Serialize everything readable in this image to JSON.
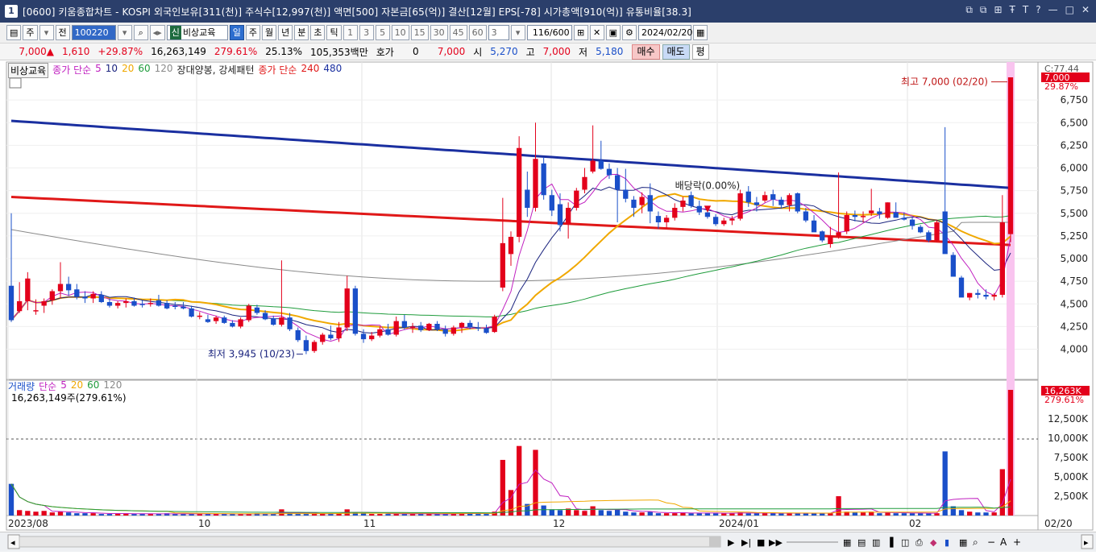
{
  "window": {
    "icon_label": "1",
    "title": "[0600] 키움종합차트 - KOSPI 외국인보유[311(천)] 주식수[12,997(천)] 액면[500] 자본금[65(억)] 결산[12월] EPS[-78] 시가총액[910(억)] 유통비율[38.3]",
    "controls": [
      "⧉",
      "⧉",
      "⊞",
      "Ŧ",
      "T",
      "?",
      "—",
      "□",
      "✕"
    ]
  },
  "toolbar": {
    "period_type": "주",
    "prev_label": "전",
    "code": "100220",
    "name_tag": "신",
    "name": "비상교육",
    "periods": [
      "일",
      "주",
      "월",
      "년",
      "분",
      "초",
      "틱"
    ],
    "intervals": [
      "1",
      "3",
      "5",
      "10",
      "15",
      "30",
      "45",
      "60"
    ],
    "interval_value": "3",
    "count": "116",
    "count_total": "/600",
    "date": "2024/02/20"
  },
  "quote": {
    "price": "7,000",
    "arrow": "▲",
    "change": "1,610",
    "change_pct": "+29.87%",
    "volume": "16,263,149",
    "volume_pct": "279.61%",
    "turnover": "25.13%",
    "amount": "105,353백만",
    "hoga_label": "호가",
    "hoga_value": "0",
    "hoga_price": "7,000",
    "open_label": "시",
    "open": "5,270",
    "high_label": "고",
    "high": "7,000",
    "low_label": "저",
    "low": "5,180",
    "buy_label": "매수",
    "sell_label": "매도",
    "avg_label": "평"
  },
  "legend_price": {
    "name": "비상교육",
    "ma_label": "종가 단순",
    "ma_periods": [
      "5",
      "10",
      "20",
      "60",
      "120"
    ],
    "pattern": "장대양봉, 강세패턴",
    "ma2_label": "종가 단순",
    "ma2_periods": [
      "240",
      "480"
    ]
  },
  "legend_volume": {
    "name": "거래량",
    "ma_label": "단순",
    "ma_periods": [
      "5",
      "20",
      "60",
      "120"
    ],
    "value_text": "16,263,149주(279.61%)"
  },
  "annotations": {
    "high": "최고 7,000 (02/20)",
    "low": "최저 3,945 (10/23)",
    "dividend": "배당락(0.00%)"
  },
  "price_axis": {
    "labels": [
      "6,750",
      "6,500",
      "6,250",
      "6,000",
      "5,750",
      "5,500",
      "5,250",
      "5,000",
      "4,750",
      "4,500",
      "4,250",
      "4,000"
    ],
    "current_label": "7,000",
    "current_pct": "29.87%",
    "top_label": "C:77.44"
  },
  "volume_axis": {
    "labels": [
      "12,500K",
      "10,000K",
      "7,500K",
      "5,000K",
      "2,500K"
    ],
    "current_label": "16,263K",
    "current_pct": "279.61%"
  },
  "date_axis": [
    "2023/08",
    "10",
    "11",
    "12",
    "2024/01",
    "02",
    "02/20"
  ],
  "colors": {
    "up": "#e3001b",
    "down": "#1a4fc9",
    "ma5": "#c020c0",
    "ma10": "#1a237e",
    "ma20": "#f0a800",
    "ma60": "#1f9c3c",
    "ma120": "#8a8a8a",
    "ma240": "#e01818",
    "ma480": "#1a2fa0",
    "today_band": "#f9c4ef"
  },
  "chart_data": {
    "type": "candlestick",
    "ylim": [
      3800,
      7000
    ],
    "volume_ylim": [
      0,
      16263
    ],
    "candles": [
      [
        4700,
        5500,
        4300,
        4320
      ],
      [
        4420,
        4740,
        4400,
        4530
      ],
      [
        4530,
        4850,
        4430,
        4780
      ],
      [
        4420,
        4550,
        4380,
        4430
      ],
      [
        4480,
        4560,
        4400,
        4530
      ],
      [
        4540,
        4660,
        4490,
        4640
      ],
      [
        4640,
        4960,
        4560,
        4720
      ],
      [
        4720,
        4800,
        4590,
        4650
      ],
      [
        4660,
        4720,
        4550,
        4580
      ],
      [
        4580,
        4640,
        4510,
        4560
      ],
      [
        4560,
        4640,
        4510,
        4610
      ],
      [
        4600,
        4640,
        4510,
        4520
      ],
      [
        4520,
        4560,
        4460,
        4480
      ],
      [
        4480,
        4530,
        4450,
        4510
      ],
      [
        4510,
        4560,
        4460,
        4530
      ],
      [
        4530,
        4570,
        4470,
        4480
      ],
      [
        4500,
        4540,
        4460,
        4490
      ],
      [
        4500,
        4560,
        4470,
        4510
      ],
      [
        4540,
        4600,
        4470,
        4480
      ],
      [
        4510,
        4540,
        4440,
        4450
      ],
      [
        4480,
        4520,
        4440,
        4470
      ],
      [
        4470,
        4520,
        4440,
        4450
      ],
      [
        4450,
        4480,
        4350,
        4360
      ],
      [
        4360,
        4410,
        4330,
        4370
      ],
      [
        4330,
        4380,
        4290,
        4300
      ],
      [
        4310,
        4370,
        4280,
        4350
      ],
      [
        4350,
        4370,
        4280,
        4290
      ],
      [
        4290,
        4320,
        4240,
        4250
      ],
      [
        4250,
        4350,
        4230,
        4330
      ],
      [
        4320,
        4500,
        4300,
        4480
      ],
      [
        4460,
        4490,
        4380,
        4400
      ],
      [
        4400,
        4430,
        4320,
        4330
      ],
      [
        4340,
        4370,
        4260,
        4270
      ],
      [
        4270,
        4980,
        4250,
        4350
      ],
      [
        4350,
        4400,
        4200,
        4220
      ],
      [
        4210,
        4240,
        4080,
        4100
      ],
      [
        4100,
        4150,
        3945,
        3980
      ],
      [
        3980,
        4100,
        3960,
        4080
      ],
      [
        4080,
        4180,
        4050,
        4160
      ],
      [
        4160,
        4260,
        4100,
        4120
      ],
      [
        4120,
        4300,
        4080,
        4240
      ],
      [
        4240,
        4810,
        4200,
        4670
      ],
      [
        4670,
        4700,
        4150,
        4170
      ],
      [
        4170,
        4220,
        4070,
        4110
      ],
      [
        4110,
        4190,
        4090,
        4150
      ],
      [
        4150,
        4250,
        4130,
        4220
      ],
      [
        4220,
        4280,
        4150,
        4160
      ],
      [
        4160,
        4360,
        4140,
        4310
      ],
      [
        4310,
        4380,
        4220,
        4240
      ],
      [
        4240,
        4290,
        4180,
        4250
      ],
      [
        4260,
        4300,
        4190,
        4210
      ],
      [
        4210,
        4290,
        4200,
        4280
      ],
      [
        4280,
        4310,
        4200,
        4220
      ],
      [
        4220,
        4260,
        4140,
        4170
      ],
      [
        4170,
        4260,
        4150,
        4240
      ],
      [
        4240,
        4300,
        4180,
        4290
      ],
      [
        4290,
        4320,
        4220,
        4240
      ],
      [
        4240,
        4300,
        4200,
        4230
      ],
      [
        4230,
        4270,
        4170,
        4180
      ],
      [
        4190,
        4380,
        4180,
        4360
      ],
      [
        4680,
        5670,
        4640,
        5170
      ],
      [
        5050,
        5300,
        4920,
        5240
      ],
      [
        5240,
        6350,
        5180,
        6220
      ],
      [
        5760,
        5960,
        5460,
        5560
      ],
      [
        5560,
        6500,
        5520,
        6100
      ],
      [
        6050,
        6120,
        5650,
        5700
      ],
      [
        5700,
        5760,
        5470,
        5530
      ],
      [
        5600,
        5720,
        5300,
        5370
      ],
      [
        5380,
        5620,
        5220,
        5560
      ],
      [
        5560,
        5780,
        5530,
        5750
      ],
      [
        5760,
        6000,
        5720,
        5900
      ],
      [
        5960,
        6470,
        5940,
        6080
      ],
      [
        6080,
        6300,
        5980,
        5990
      ],
      [
        5990,
        6050,
        5880,
        5920
      ],
      [
        5920,
        6000,
        5400,
        5760
      ],
      [
        5760,
        5990,
        5620,
        5660
      ],
      [
        5650,
        5690,
        5460,
        5560
      ],
      [
        5590,
        5730,
        5500,
        5680
      ],
      [
        5700,
        5830,
        5390,
        5520
      ],
      [
        5470,
        5520,
        5330,
        5400
      ],
      [
        5400,
        5480,
        5330,
        5450
      ],
      [
        5450,
        5610,
        5420,
        5560
      ],
      [
        5570,
        5680,
        5520,
        5640
      ],
      [
        5700,
        5740,
        5560,
        5580
      ],
      [
        5580,
        5640,
        5480,
        5510
      ],
      [
        5510,
        5540,
        5440,
        5460
      ],
      [
        5460,
        5490,
        5360,
        5380
      ],
      [
        5380,
        5450,
        5360,
        5420
      ],
      [
        5420,
        5470,
        5370,
        5440
      ],
      [
        5440,
        5760,
        5420,
        5720
      ],
      [
        5740,
        5800,
        5570,
        5620
      ],
      [
        5620,
        5680,
        5520,
        5590
      ],
      [
        5640,
        5740,
        5620,
        5700
      ],
      [
        5710,
        5760,
        5580,
        5650
      ],
      [
        5650,
        5680,
        5560,
        5590
      ],
      [
        5590,
        5720,
        5520,
        5700
      ],
      [
        5720,
        5730,
        5500,
        5520
      ],
      [
        5520,
        5560,
        5400,
        5420
      ],
      [
        5420,
        5480,
        5300,
        5290
      ],
      [
        5300,
        5310,
        5180,
        5200
      ],
      [
        5160,
        5350,
        5120,
        5250
      ],
      [
        5250,
        5950,
        5220,
        5290
      ],
      [
        5300,
        5520,
        5270,
        5480
      ],
      [
        5480,
        5530,
        5410,
        5460
      ],
      [
        5460,
        5520,
        5400,
        5470
      ],
      [
        5500,
        5770,
        5470,
        5530
      ],
      [
        5520,
        5560,
        5440,
        5490
      ],
      [
        5450,
        5620,
        5440,
        5620
      ],
      [
        5510,
        5620,
        5480,
        5450
      ],
      [
        5450,
        5510,
        5420,
        5430
      ],
      [
        5430,
        5460,
        5320,
        5360
      ],
      [
        5350,
        5370,
        5280,
        5290
      ],
      [
        5290,
        5310,
        5180,
        5200
      ],
      [
        5200,
        5420,
        5180,
        5400
      ],
      [
        5520,
        6450,
        5090,
        5050
      ],
      [
        5040,
        5070,
        4900,
        4800
      ],
      [
        4790,
        4810,
        4600,
        4570
      ],
      [
        4570,
        4620,
        4540,
        4620
      ],
      [
        4620,
        4660,
        4560,
        4600
      ],
      [
        4600,
        4660,
        4550,
        4580
      ],
      [
        4580,
        4620,
        4540,
        4600
      ],
      [
        4600,
        5700,
        4570,
        5400
      ],
      [
        5270,
        7000,
        5180,
        7000
      ]
    ],
    "volumes": [
      4100,
      700,
      600,
      500,
      600,
      400,
      500,
      400,
      300,
      300,
      300,
      200,
      200,
      300,
      300,
      200,
      200,
      200,
      200,
      300,
      200,
      200,
      200,
      300,
      200,
      200,
      200,
      200,
      200,
      200,
      300,
      200,
      200,
      800,
      300,
      200,
      200,
      200,
      300,
      300,
      300,
      800,
      400,
      300,
      200,
      200,
      200,
      300,
      200,
      200,
      200,
      200,
      200,
      200,
      300,
      300,
      300,
      200,
      200,
      500,
      7200,
      3300,
      9000,
      1500,
      8500,
      1300,
      800,
      700,
      900,
      700,
      600,
      1200,
      700,
      600,
      800,
      500,
      400,
      400,
      500,
      300,
      300,
      300,
      400,
      300,
      300,
      300,
      300,
      300,
      300,
      400,
      300,
      300,
      300,
      300,
      300,
      300,
      300,
      300,
      300,
      300,
      300,
      2500,
      500,
      400,
      400,
      500,
      300,
      400,
      300,
      300,
      300,
      300,
      300,
      300,
      8300,
      1200,
      700,
      500,
      400,
      400,
      400,
      6000,
      16263
    ]
  }
}
